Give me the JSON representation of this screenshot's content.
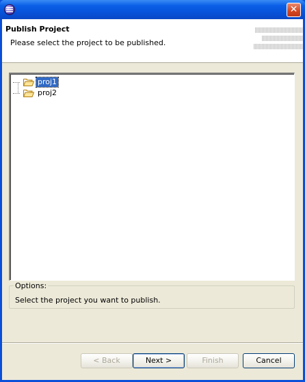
{
  "window": {
    "title": "",
    "close_glyph": "✕"
  },
  "header": {
    "title": "Publish Project",
    "message": "Please select the project to be published."
  },
  "tree": {
    "items": [
      {
        "label": "proj1",
        "selected": true,
        "icon": "folder-open-icon"
      },
      {
        "label": "proj2",
        "selected": false,
        "icon": "folder-open-icon"
      }
    ]
  },
  "options": {
    "legend": "Options:",
    "text": "Select the project you want to publish."
  },
  "buttons": {
    "back": "< Back",
    "next": "Next >",
    "finish": "Finish",
    "cancel": "Cancel"
  },
  "colors": {
    "titlebar": "#0a5ee6",
    "selection": "#316ac5",
    "dialog_bg": "#ece9d8"
  }
}
